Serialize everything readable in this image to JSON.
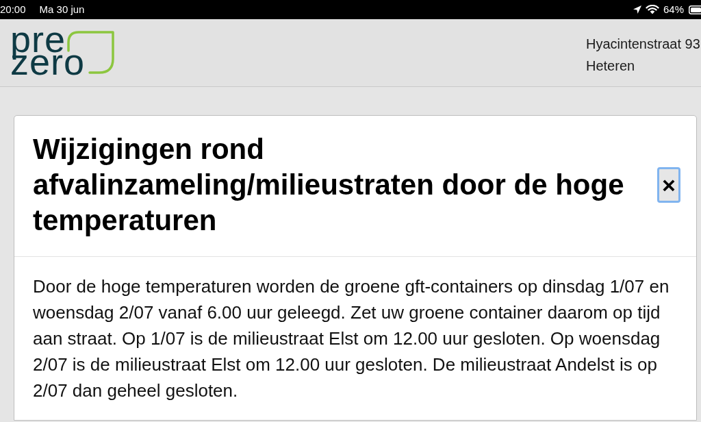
{
  "status_bar": {
    "time": "20:00",
    "date": "Ma 30 jun",
    "battery": "64%"
  },
  "header": {
    "logo": [
      "pre",
      "zero"
    ],
    "address": [
      "Hyacintenstraat 93",
      "Heteren"
    ]
  },
  "modal": {
    "title": "Wijzigingen rond afvalinzameling/milieustraten door de hoge temperaturen",
    "close_button": {
      "label": "×",
      "focused": true
    },
    "body": "Door de hoge temperaturen worden de groene gft-containers op dinsdag 1/07 en woensdag 2/07 vanaf 6.00 uur geleegd. Zet uw groene container daarom op tijd aan straat. Op 1/07 is de milieustraat Elst om 12.00 uur gesloten. Op woensdag 2/07 is de milieustraat Elst om 12.00 uur gesloten. De milieustraat Andelst is op 2/07 dan geheel gesloten."
  }
}
